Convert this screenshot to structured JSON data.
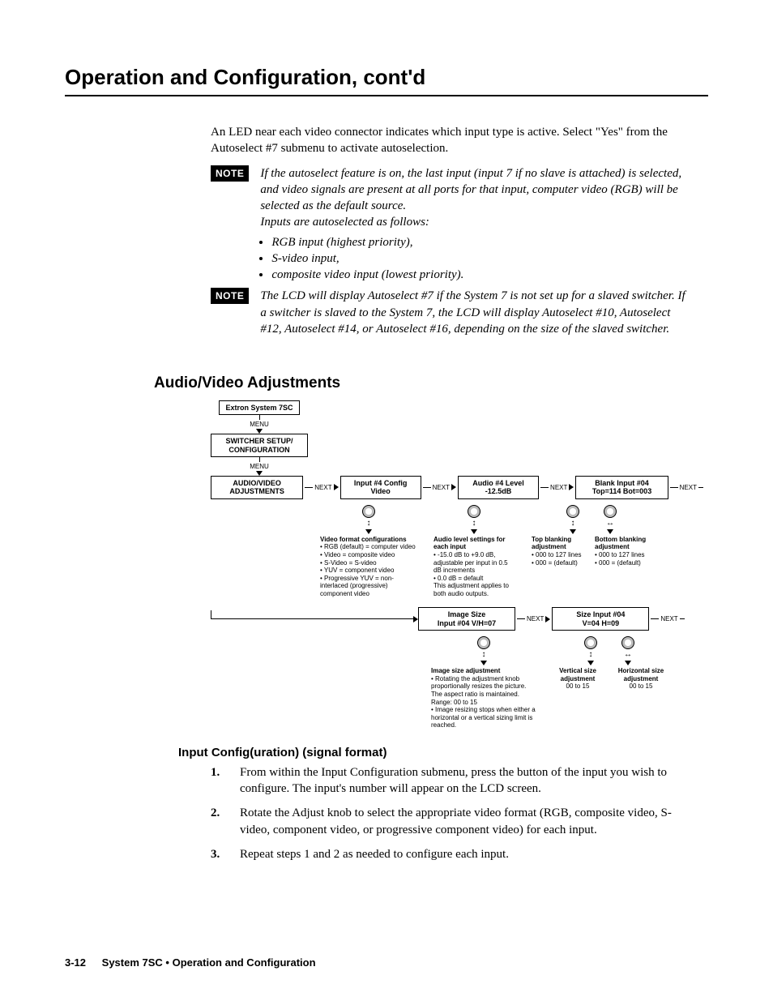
{
  "header": {
    "title": "Operation and Configuration, cont'd"
  },
  "intro": "An LED near each video connector indicates which input type is active.  Select \"Yes\" from the Autoselect #7 submenu to activate autoselection.",
  "note1": {
    "label": "NOTE",
    "body": "If the autoselect feature is on, the last input (input 7 if no slave is attached) is selected, and video signals are present at all ports for that input, computer video (RGB) will be selected as the default source.\nInputs are autoselected as follows:",
    "bullets": [
      "RGB input (highest priority),",
      "S-video input,",
      "composite video input (lowest priority)."
    ]
  },
  "note2": {
    "label": "NOTE",
    "body": "The LCD will display Autoselect #7 if the System 7 is not set up for a slaved switcher.  If a switcher is slaved to the System 7, the LCD will display Autoselect #10, Autoselect #12, Autoselect #14, or Autoselect #16, depending on the size of the slaved switcher."
  },
  "section": {
    "h2": "Audio/Video Adjustments",
    "h3": "Input Config(uration) (signal format)"
  },
  "steps": [
    {
      "n": "1.",
      "t": "From within the Input Configuration submenu, press the button of the input you wish to configure.  The input's number will appear on the LCD screen."
    },
    {
      "n": "2.",
      "t": "Rotate the Adjust knob to select the appropriate video format (RGB, composite video, S-video, component video, or progressive component video) for each input."
    },
    {
      "n": "3.",
      "t": "Repeat steps 1 and 2 as needed to configure each input."
    }
  ],
  "footer": {
    "page": "3-12",
    "title": "System 7SC • Operation and Configuration"
  },
  "flow": {
    "menu_label": "MENU",
    "next_label": "NEXT",
    "boxes": {
      "b0": "Extron\nSystem 7SC",
      "b1": "SWITCHER SETUP/\nCONFIGURATION",
      "b2": "AUDIO/VIDEO\nADJUSTMENTS",
      "b3a": "Input #4 Config",
      "b3b": "Video",
      "b4a": "Audio #4 Level",
      "b4b": "-12.5dB",
      "b5a": "Blank Input #04",
      "b5b": "Top=114     Bot=003",
      "b6a": "Image Size",
      "b6b": "Input #04    V/H=07",
      "b7a": "Size Input #04",
      "b7b": "V=04          H=09"
    },
    "desc": {
      "d3_title": "Video format configurations",
      "d3_rows": [
        [
          "RGB (default)",
          "computer video"
        ],
        [
          "Video",
          "composite video"
        ],
        [
          "S-Video",
          "S-video"
        ],
        [
          "YUV",
          "component video"
        ],
        [
          "Progressive YUV",
          "non-interlaced (progressive) component video"
        ]
      ],
      "d4_title": "Audio level settings for each input",
      "d4_lines": [
        "-15.0 dB to +9.0 dB, adjustable per input in 0.5 dB increments",
        "0.0 dB = default",
        "This adjustment applies to both audio outputs."
      ],
      "d5a_title": "Top blanking adjustment",
      "d5a_lines": [
        "000 to 127 lines",
        "000 = (default)"
      ],
      "d5b_title": "Bottom blanking adjustment",
      "d5b_lines": [
        "000 to 127 lines",
        "000 = (default)"
      ],
      "d6_title": "Image size adjustment",
      "d6_lines": [
        "Rotating the adjustment knob proportionally resizes the picture. The aspect ratio is maintained.  Range: 00 to 15",
        "Image resizing stops when either a horizontal or a vertical sizing limit is reached."
      ],
      "d7a_title": "Vertical size adjustment",
      "d7a_line": "00 to 15",
      "d7b_title": "Horizontal size adjustment",
      "d7b_line": "00 to 15"
    }
  }
}
